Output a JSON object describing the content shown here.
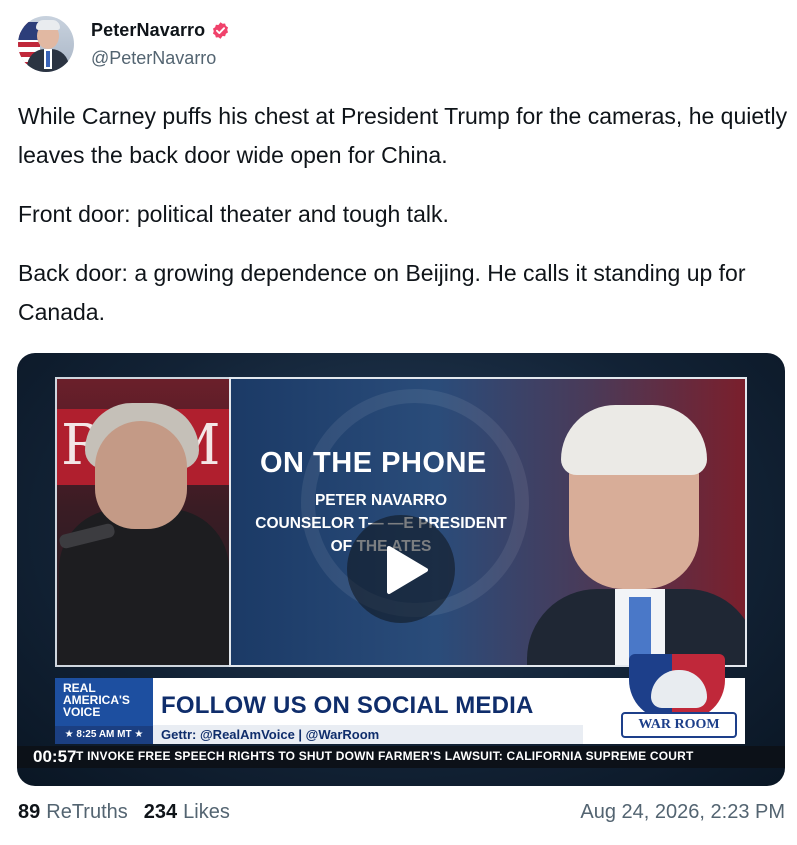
{
  "author": {
    "display_name": "PeterNavarro",
    "handle": "@PeterNavarro",
    "verified": true,
    "verified_color": "#f0426b"
  },
  "post": {
    "paragraphs": [
      "While Carney puffs his chest at President Trump for the cameras, he quietly leaves the back door wide open for China.",
      "Front door: political theater and tough talk.",
      "Back door: a growing dependence on Beijing. He calls it standing up for Canada."
    ]
  },
  "video": {
    "duration": "00:57",
    "overlay_title": "ON THE PHONE",
    "overlay_name": "PETER NAVARRO",
    "overlay_role_line1": "COUNSELOR T— —E PRESIDENT",
    "overlay_role_line2": "OF THE          ATES",
    "channel_logo_text": "REAL AMERICA'S VOICE",
    "channel_time": "★ 8:25 AM MT ★",
    "banner_headline": "FOLLOW US ON SOCIAL MEDIA",
    "banner_sub": "Gettr: @RealAmVoice | @WarRoom",
    "show_logo": "WAR ROOM",
    "ticker": "'T INVOKE FREE SPEECH RIGHTS TO SHUT DOWN FARMER'S LAWSUIT: CALIFORNIA SUPREME COURT"
  },
  "stats": {
    "retruths_count": "89",
    "retruths_label": "ReTruths",
    "likes_count": "234",
    "likes_label": "Likes"
  },
  "timestamp": "Aug 24, 2026, 2:23 PM"
}
